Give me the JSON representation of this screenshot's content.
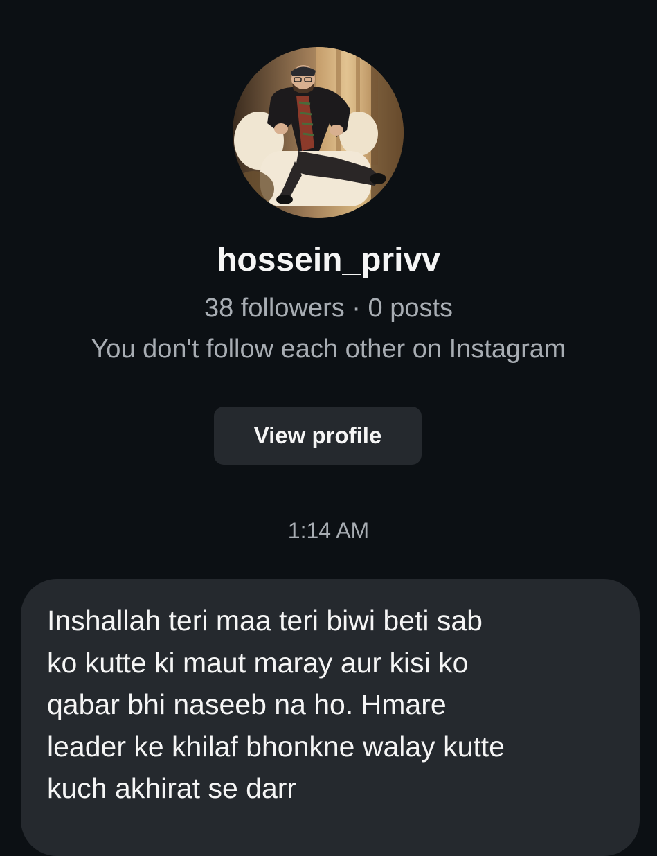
{
  "profile": {
    "username": "hossein_privv",
    "stats": "38 followers · 0 posts",
    "follow_status": "You don't follow each other on Instagram",
    "view_profile_label": "View profile"
  },
  "thread": {
    "timestamp": "1:14 AM",
    "messages": [
      {
        "lines": [
          "Inshallah teri maa teri biwi beti sab",
          "ko kutte ki maut maray aur kisi ko",
          "qabar bhi naseeb na ho. Hmare",
          "leader ke khilaf bhonkne walay kutte",
          "kuch akhirat se darr"
        ]
      }
    ]
  },
  "colors": {
    "background": "#0c1014",
    "bubble": "#25292e",
    "button": "#25292e",
    "primary_text": "#f5f5f5",
    "secondary_text": "#a8adb3"
  }
}
